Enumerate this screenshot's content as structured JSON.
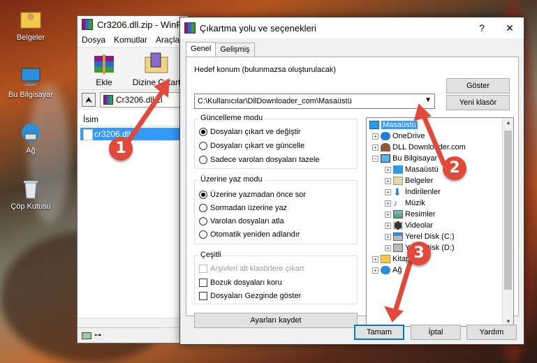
{
  "desktop": {
    "icons": [
      {
        "label": "Belgeler",
        "icon": "folder-user-icon"
      },
      {
        "label": "Bu Bilgisayar",
        "icon": "computer-icon"
      },
      {
        "label": "Ağ",
        "icon": "network-icon"
      },
      {
        "label": "Çöp Kutusu",
        "icon": "recycle-bin-icon"
      }
    ]
  },
  "winrar": {
    "title": "Cr3206.dll.zip - WinR",
    "menu": [
      "Dosya",
      "Komutlar",
      "Araçla"
    ],
    "toolbar": {
      "add_label": "Ekle",
      "extract_label": "Dizine Çıkart"
    },
    "path": "Cr3206.dll.zi",
    "column_name": "İsim",
    "file_row": "cr3206.dll"
  },
  "dialog": {
    "title": "Çıkartma yolu ve seçenekleri",
    "help_glyph": "?",
    "close_glyph": "✕",
    "tabs": [
      "Genel",
      "Gelişmiş"
    ],
    "target_label": "Hedef konum (bulunmazsa oluşturulacak)",
    "target_value": "C:\\Kullanıcılar\\DllDownloader_com\\Masaüstü",
    "show_button": "Göster",
    "new_folder_button": "Yeni klasör",
    "update_mode": {
      "title": "Güncelleme modu",
      "options": [
        "Dosyaları çıkart ve değiştir",
        "Dosyaları çıkart ve güncelle",
        "Sadece varolan dosyaları tazele"
      ],
      "selected": 0
    },
    "overwrite_mode": {
      "title": "Üzerine yaz modu",
      "options": [
        "Üzerine yazmadan önce sor",
        "Sormadan üzerine yaz",
        "Varolan dosyaları atla",
        "Otomatik yeniden adlandır"
      ],
      "selected": 0
    },
    "misc": {
      "title": "Çeşitli",
      "options": [
        "Arşivleri alt klasörlere çıkart",
        "Bozuk dosyaları koru",
        "Dosyaları Gezginde göster"
      ]
    },
    "save_settings_button": "Ayarları kaydet",
    "tree": [
      {
        "label": "Masaüstü",
        "icon": "desktop-icon",
        "selected": true
      },
      {
        "label": "OneDrive",
        "icon": "onedrive-icon"
      },
      {
        "label": "DLL Downloader.com",
        "icon": "user-icon"
      },
      {
        "label": "Bu Bilgisayar",
        "icon": "computer-icon"
      },
      {
        "label": "Masaüstü",
        "icon": "desktop-icon"
      },
      {
        "label": "Belgeler",
        "icon": "documents-icon"
      },
      {
        "label": "İndirilenler",
        "icon": "downloads-icon"
      },
      {
        "label": "Müzik",
        "icon": "music-icon"
      },
      {
        "label": "Resimler",
        "icon": "pictures-icon"
      },
      {
        "label": "Videolar",
        "icon": "videos-icon"
      },
      {
        "label": "Yerel Disk (C:)",
        "icon": "drive-icon"
      },
      {
        "label": "Yerel Disk (D:)",
        "icon": "drive-icon"
      },
      {
        "label": "Kitaplıklar",
        "icon": "libraries-icon"
      },
      {
        "label": "Ağ",
        "icon": "network-icon"
      }
    ],
    "ok_button": "Tamam",
    "cancel_button": "İptal",
    "help_button": "Yardım"
  },
  "annotations": [
    "1",
    "2",
    "3"
  ],
  "colors": {
    "selection": "#3399ff",
    "badge": "#e14a3a",
    "focus_border": "#0078d7"
  }
}
